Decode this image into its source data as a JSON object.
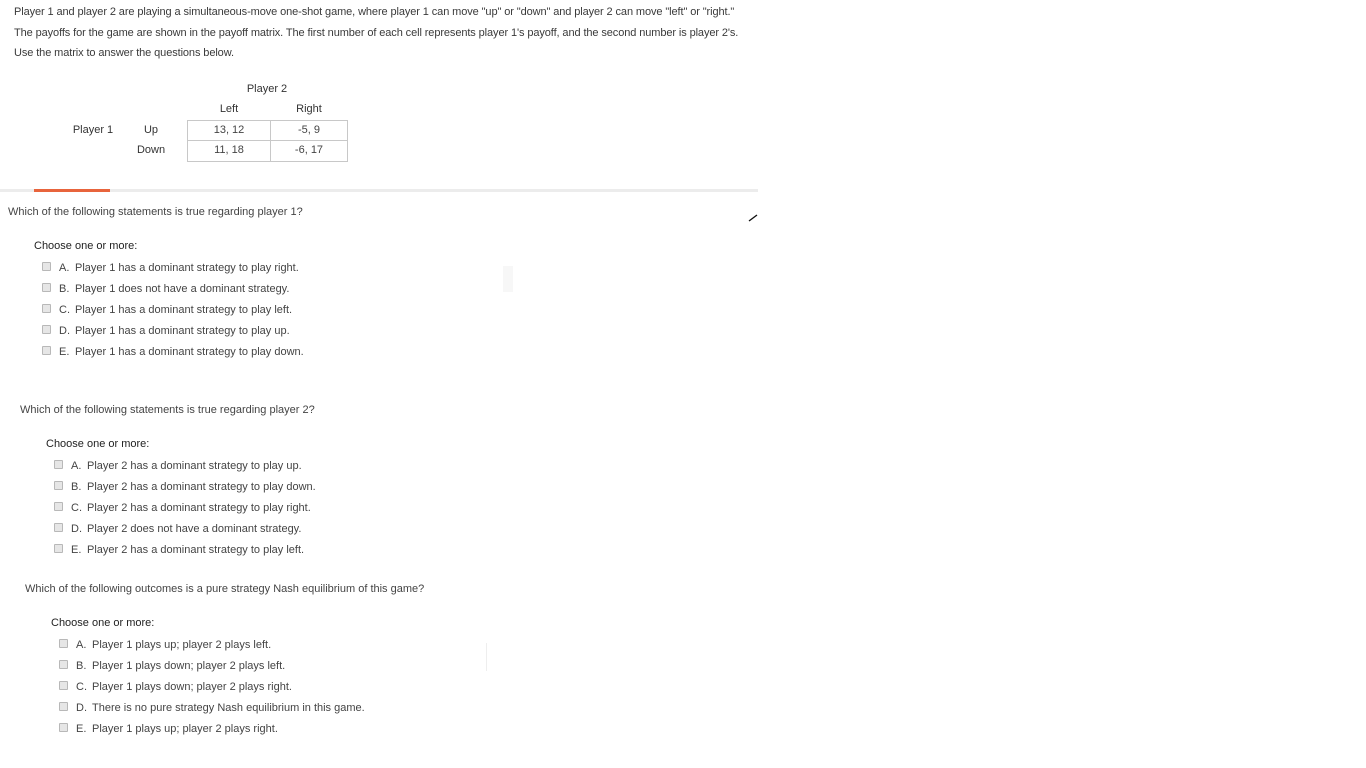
{
  "intro": "Player 1 and player 2 are playing a simultaneous-move one-shot game, where player 1 can move \"up\" or \"down\" and player 2 can move \"left\" or \"right.\" The payoffs for the game are shown in the payoff matrix. The first number of each cell represents player 1's payoff, and the second number is player 2's. Use the matrix to answer the questions below.",
  "matrix": {
    "col_player": "Player 2",
    "row_player": "Player 1",
    "col_headers": [
      "Left",
      "Right"
    ],
    "row_headers": [
      "Up",
      "Down"
    ],
    "cells": [
      [
        "13, 12",
        "-5, 9"
      ],
      [
        "11, 18",
        "-6, 17"
      ]
    ]
  },
  "questions": [
    {
      "title": "Which of the following statements is true regarding player 1?",
      "instruction": "Choose one or more:",
      "options": [
        {
          "letter": "A.",
          "text": "Player 1 has a dominant strategy to play right.",
          "checked": false
        },
        {
          "letter": "B.",
          "text": "Player 1 does not have a dominant strategy.",
          "checked": false
        },
        {
          "letter": "C.",
          "text": "Player 1 has a dominant strategy to play left.",
          "checked": false
        },
        {
          "letter": "D.",
          "text": "Player 1 has a dominant strategy to play up.",
          "checked": false
        },
        {
          "letter": "E.",
          "text": "Player 1 has a dominant strategy to play down.",
          "checked": false
        }
      ]
    },
    {
      "title": "Which of the following statements is true regarding player 2?",
      "instruction": "Choose one or more:",
      "options": [
        {
          "letter": "A.",
          "text": "Player 2 has a dominant strategy to play up.",
          "checked": false
        },
        {
          "letter": "B.",
          "text": "Player 2 has a dominant strategy to play down.",
          "checked": false
        },
        {
          "letter": "C.",
          "text": "Player 2 has a dominant strategy to play right.",
          "checked": false
        },
        {
          "letter": "D.",
          "text": "Player 2 does not have a dominant strategy.",
          "checked": false
        },
        {
          "letter": "E.",
          "text": "Player 2 has a dominant strategy to play left.",
          "checked": false
        }
      ]
    },
    {
      "title": "Which of the following outcomes is a pure strategy Nash equilibrium of this game?",
      "instruction": "Choose one or more:",
      "options": [
        {
          "letter": "A.",
          "text": "Player 1 plays up; player 2 plays left.",
          "checked": false
        },
        {
          "letter": "B.",
          "text": "Player 1 plays down; player 2 plays left.",
          "checked": false
        },
        {
          "letter": "C.",
          "text": "Player 1 plays down; player 2 plays right.",
          "checked": false
        },
        {
          "letter": "D.",
          "text": "There is no pure strategy Nash equilibrium in this game.",
          "checked": false
        },
        {
          "letter": "E.",
          "text": "Player 1 plays up; player 2 plays right.",
          "checked": false
        }
      ]
    }
  ],
  "colors": {
    "accent": "#e8643c",
    "divider": "#ececec",
    "cell_border": "#c8c8c8"
  }
}
